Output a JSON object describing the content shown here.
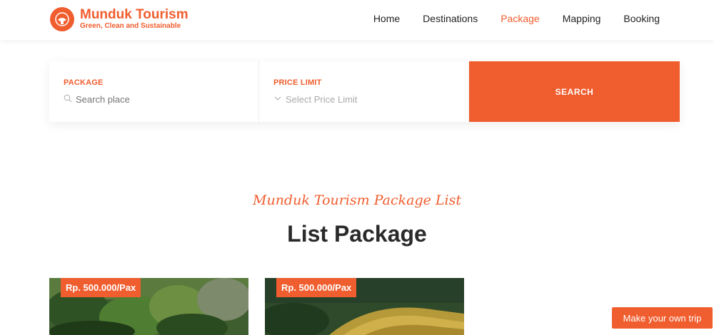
{
  "brand": {
    "name": "Munduk Tourism",
    "tagline": "Green, Clean and Sustainable",
    "accent_color": "#f05d2e"
  },
  "nav": {
    "items": [
      {
        "label": "Home"
      },
      {
        "label": "Destinations"
      },
      {
        "label": "Package"
      },
      {
        "label": "Mapping"
      },
      {
        "label": "Booking"
      }
    ],
    "active": "Package"
  },
  "search": {
    "package_label": "PACKAGE",
    "package_placeholder": "Search place",
    "price_label": "PRICE LIMIT",
    "price_selected": "Select Price Limit",
    "button_label": "SEARCH"
  },
  "section": {
    "script_title": "Munduk Tourism Package List",
    "title": "List Package"
  },
  "packages": [
    {
      "price": "Rp. 500.000/Pax",
      "image": "forest-cliff-photo"
    },
    {
      "price": "Rp. 500.000/Pax",
      "image": "rice-terrace-photo"
    }
  ],
  "floating_button": {
    "label": "Make your own trip"
  }
}
